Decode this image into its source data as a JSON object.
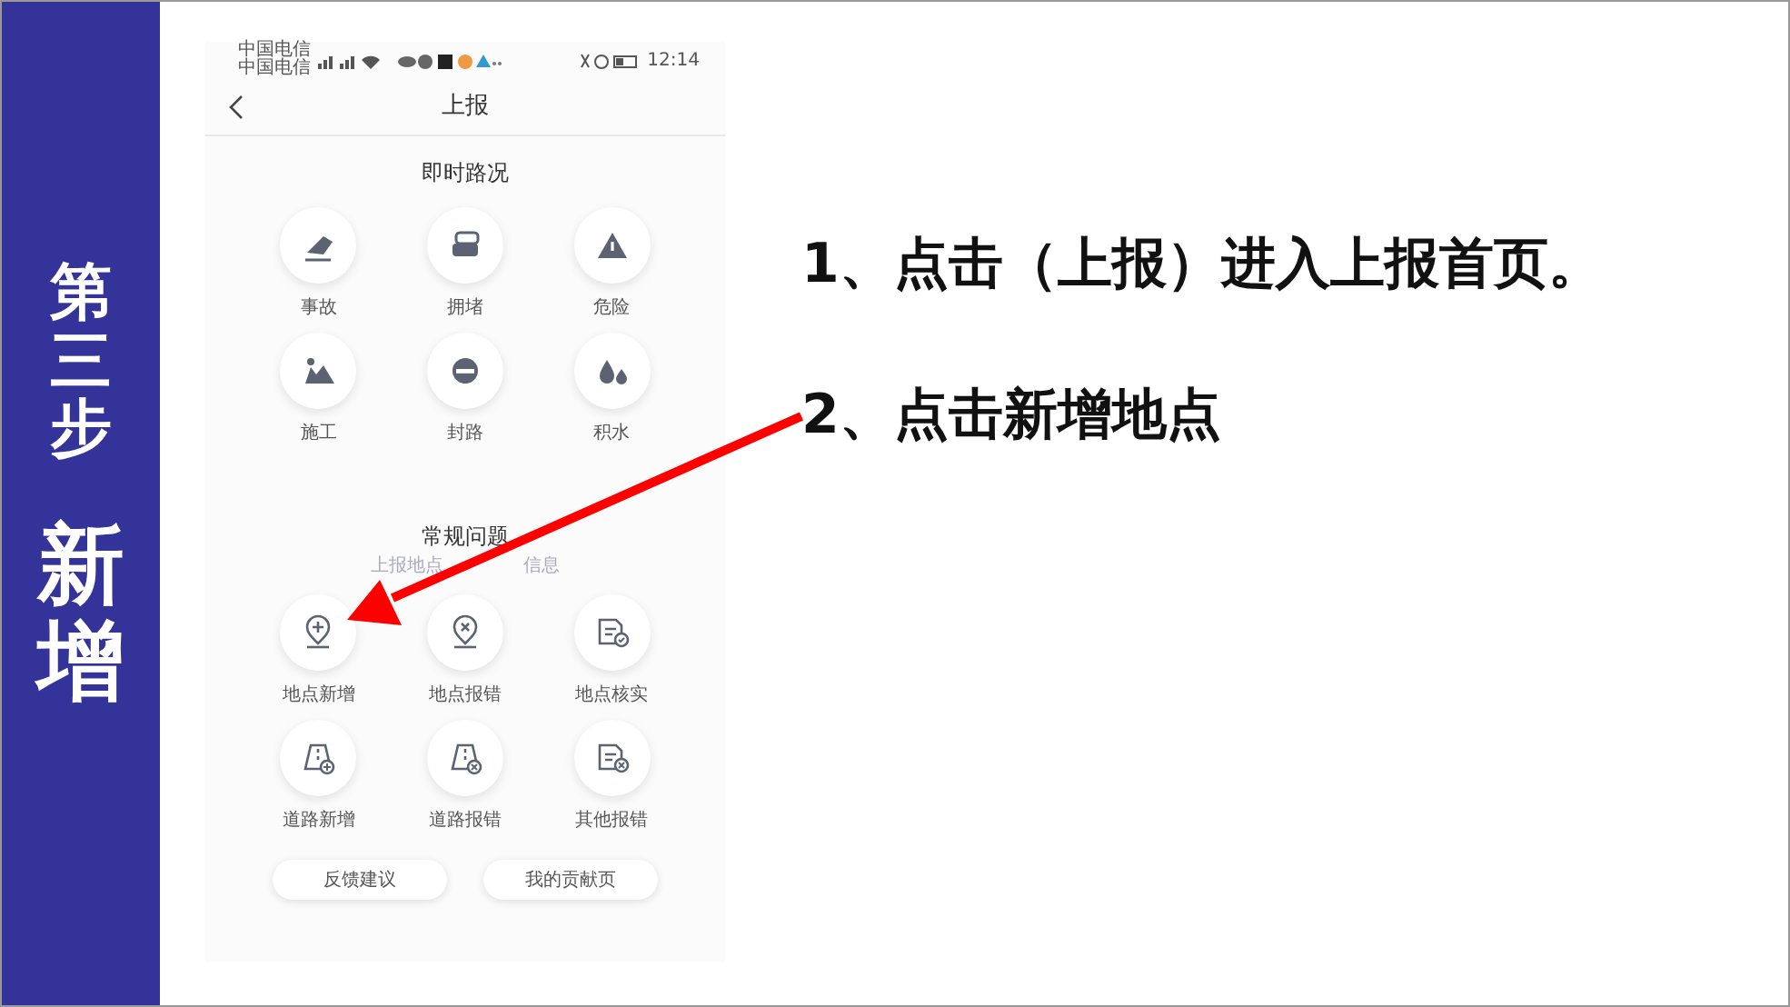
{
  "sidebar": {
    "step": "第三步",
    "title": "新增"
  },
  "phone": {
    "status_bar": {
      "carriers": [
        "中国电信",
        "中国电信"
      ],
      "time": "12:14"
    },
    "header": {
      "title": "上报"
    },
    "sections": [
      {
        "title": "即时路况",
        "items": [
          {
            "label": "事故"
          },
          {
            "label": "拥堵"
          },
          {
            "label": "危险"
          },
          {
            "label": "施工"
          },
          {
            "label": "封路"
          },
          {
            "label": "积水"
          }
        ]
      },
      {
        "title": "常规问题",
        "subtitle_parts": [
          "上报地点",
          "信息"
        ],
        "items": [
          {
            "label": "地点新增"
          },
          {
            "label": "地点报错"
          },
          {
            "label": "地点核实"
          },
          {
            "label": "道路新增"
          },
          {
            "label": "道路报错"
          },
          {
            "label": "其他报错"
          }
        ]
      }
    ],
    "buttons": [
      "反馈建议",
      "我的贡献页"
    ]
  },
  "instructions": [
    "1、点击（上报）进入上报首页。",
    "2、点击新增地点"
  ]
}
